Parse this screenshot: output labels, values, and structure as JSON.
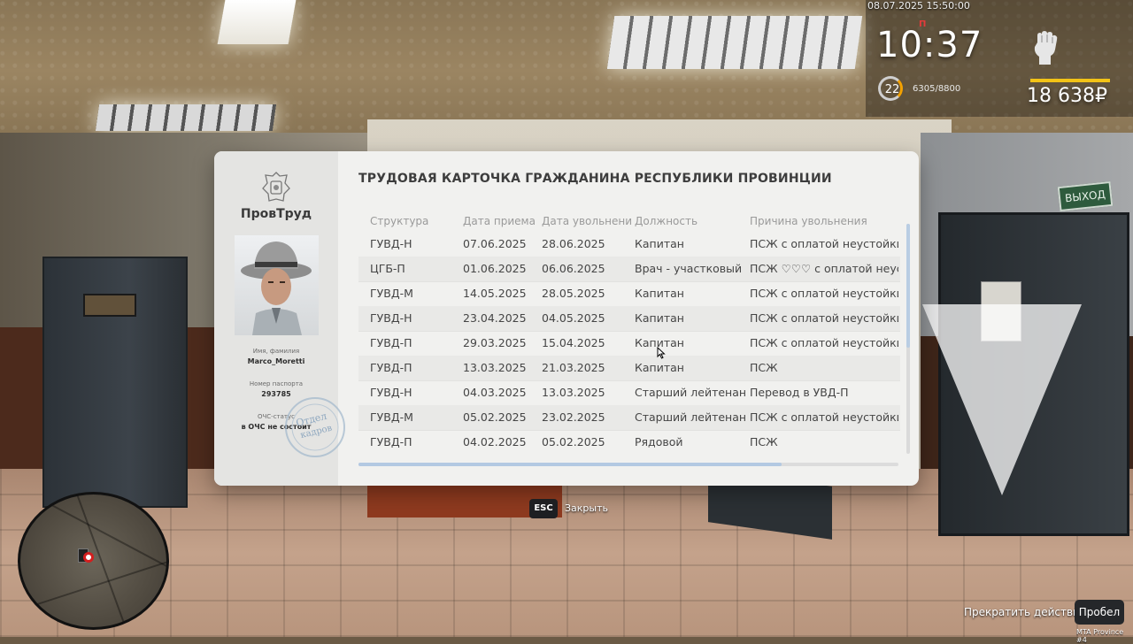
{
  "hud": {
    "datetime": "08.07.2025 15:50:00",
    "notif_badge": "П",
    "clock": "10:37",
    "level": "22",
    "xp": "6305/8800",
    "xp_progress": 0.72,
    "money": "18 638₽",
    "icons": {
      "fist": "fist-icon",
      "level": "level-ring-icon"
    },
    "accent_color": "#f3c316"
  },
  "world": {
    "exit_sign": "ВЫХОД"
  },
  "card": {
    "org_name": "ПровТруд",
    "title": "ТРУДОВАЯ КАРТОЧКА ГРАЖДАНИНА РЕСПУБЛИКИ ПРОВИНЦИИ",
    "name_label": "Имя, фамилия",
    "name_value": "Marco_Moretti",
    "passport_label": "Номер паспорта",
    "passport_value": "293785",
    "ochs_label": "ОЧС-статус",
    "ochs_value": "в ОЧС не состоит",
    "stamp_text_1": "Отдел",
    "stamp_text_2": "кадров",
    "columns": [
      "Структура",
      "Дата приема",
      "Дата увольнени",
      "Должность",
      "Причина увольнения"
    ],
    "rows": [
      [
        "ГУВД-Н",
        "07.06.2025",
        "28.06.2025",
        "Капитан",
        "ПСЖ с оплатой неустойки"
      ],
      [
        "ЦГБ-П",
        "01.06.2025",
        "06.06.2025",
        "Врач - участковый",
        "ПСЖ ♡♡♡ с оплатой неустойки"
      ],
      [
        "ГУВД-М",
        "14.05.2025",
        "28.05.2025",
        "Капитан",
        "ПСЖ с оплатой неустойки"
      ],
      [
        "ГУВД-Н",
        "23.04.2025",
        "04.05.2025",
        "Капитан",
        "ПСЖ с оплатой неустойки"
      ],
      [
        "ГУВД-П",
        "29.03.2025",
        "15.04.2025",
        "Капитан",
        "ПСЖ с оплатой неустойки"
      ],
      [
        "ГУВД-П",
        "13.03.2025",
        "21.03.2025",
        "Капитан",
        "ПСЖ"
      ],
      [
        "ГУВД-Н",
        "04.03.2025",
        "13.03.2025",
        "Старший лейтенант",
        "Перевод в УВД-П"
      ],
      [
        "ГУВД-М",
        "05.02.2025",
        "23.02.2025",
        "Старший лейтенант",
        "ПСЖ с оплатой неустойки."
      ],
      [
        "ГУВД-П",
        "04.02.2025",
        "05.02.2025",
        "Рядовой",
        "ПСЖ"
      ]
    ]
  },
  "prompts": {
    "esc_key": "ESC",
    "esc_label": "Закрыть",
    "stop_label": "Прекратить действие",
    "space_key": "Пробел"
  },
  "watermark": "MTA Province #4"
}
